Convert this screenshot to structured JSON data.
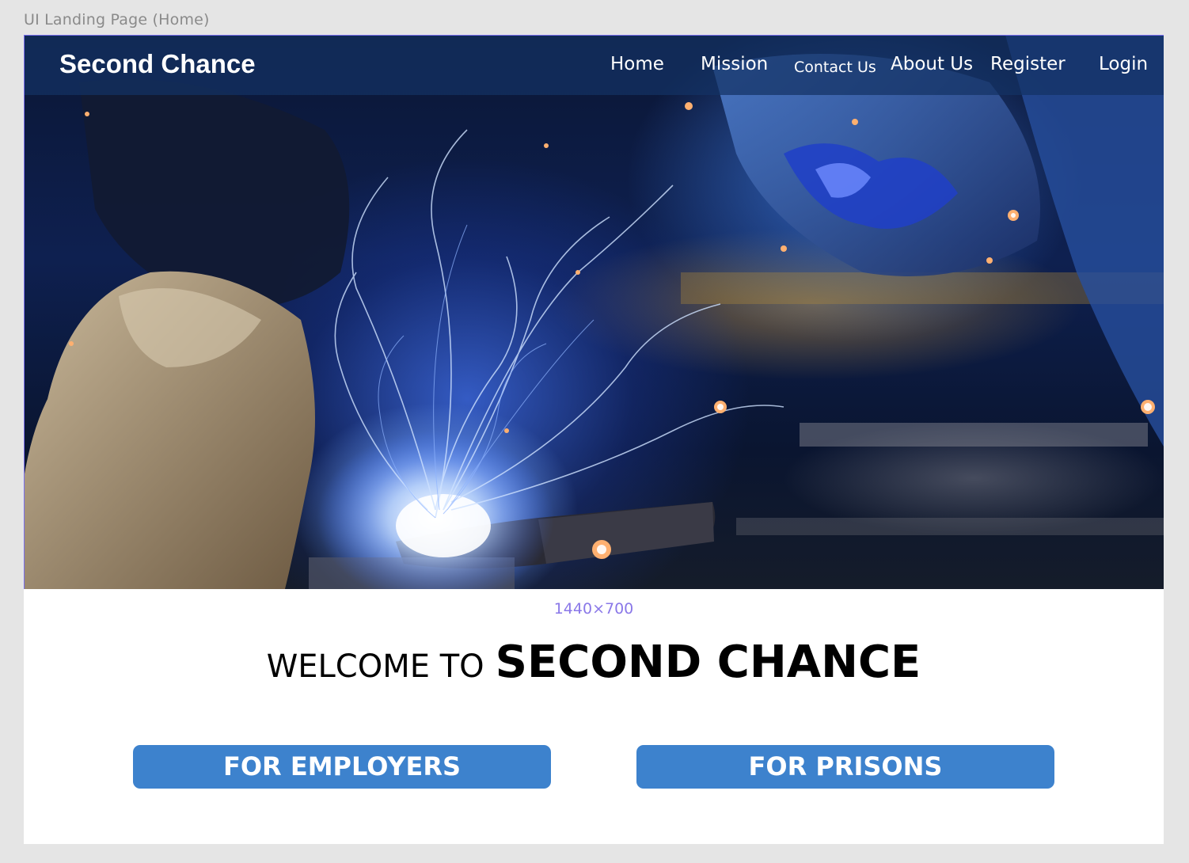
{
  "frame": {
    "label": "UI Landing Page (Home)",
    "dimensions": "1440×700"
  },
  "navbar": {
    "brand": "Second Chance",
    "links": [
      {
        "label": "Home"
      },
      {
        "label": "Mission"
      },
      {
        "label": "Contact Us"
      },
      {
        "label": "About Us"
      },
      {
        "label": "Register"
      },
      {
        "label": "Login"
      }
    ]
  },
  "hero": {
    "image": "welding-sparks-photo"
  },
  "welcome": {
    "prefix": "WELCOME TO",
    "name": "SECOND CHANCE"
  },
  "buttons": {
    "employers": "FOR EMPLOYERS",
    "prisons": "FOR PRISONS"
  },
  "colors": {
    "button": "#3d82cd",
    "frame_accent": "#7a6ff0",
    "navbar": "#143264"
  }
}
